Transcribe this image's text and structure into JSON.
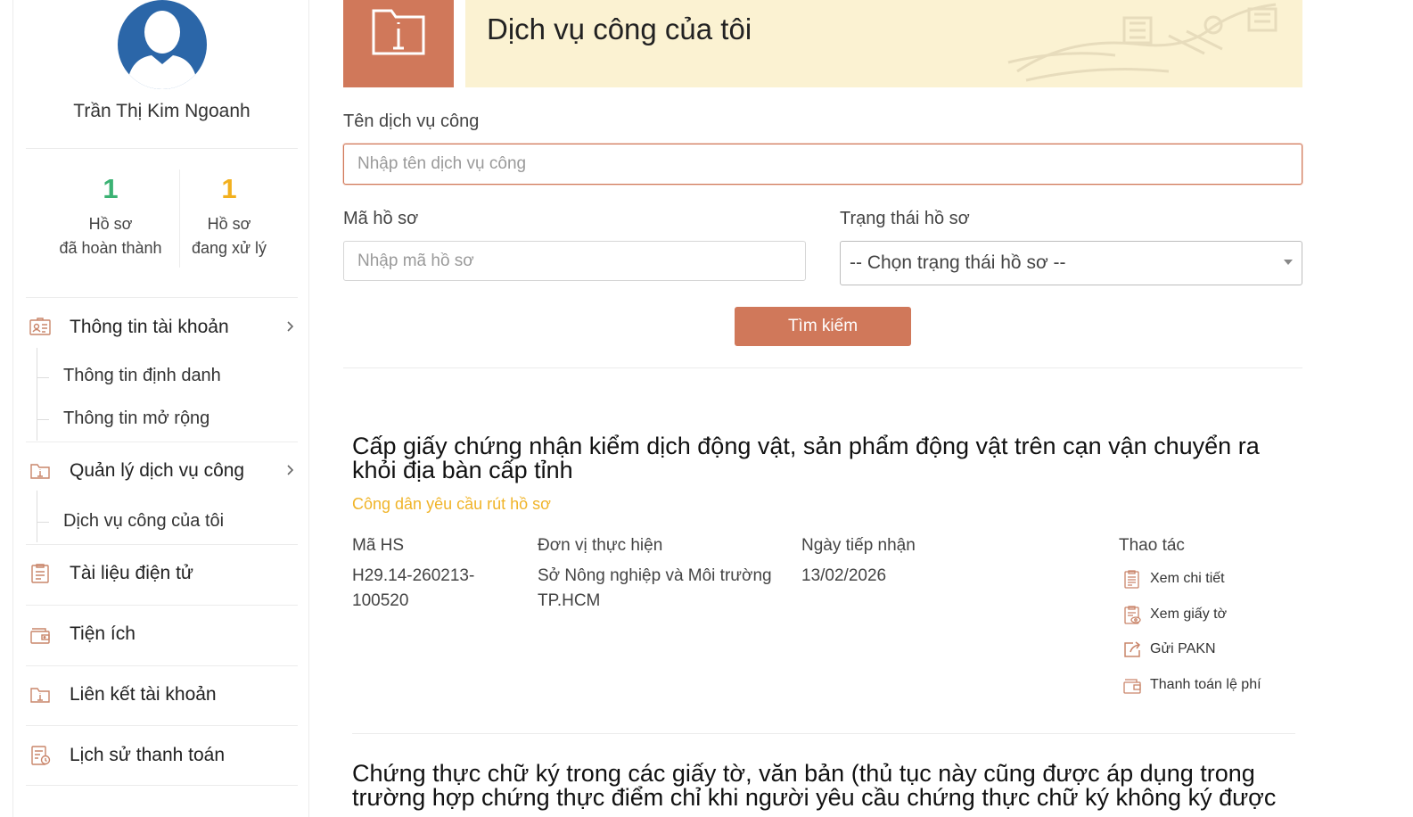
{
  "user": {
    "name": "Trần Thị Kim Ngoanh"
  },
  "stats": {
    "completed": {
      "count": "1",
      "line1": "Hồ sơ",
      "line2": "đã hoàn thành",
      "color": "#3bb273"
    },
    "processing": {
      "count": "1",
      "line1": "Hồ sơ",
      "line2": "đang xử lý",
      "color": "#f2b01e"
    }
  },
  "menu": {
    "account": {
      "label": "Thông tin tài khoản",
      "sub": [
        "Thông tin định danh",
        "Thông tin mở rộng"
      ]
    },
    "services": {
      "label": "Quản lý dịch vụ công",
      "sub": [
        "Dịch vụ công của tôi"
      ]
    },
    "documents": {
      "label": "Tài liệu điện tử"
    },
    "utilities": {
      "label": "Tiện ích"
    },
    "links": {
      "label": "Liên kết tài khoản"
    },
    "payments": {
      "label": "Lịch sử thanh toán"
    }
  },
  "banner": {
    "title": "Dịch vụ công của tôi"
  },
  "search": {
    "service_label": "Tên dịch vụ công",
    "service_placeholder": "Nhập tên dịch vụ công",
    "code_label": "Mã hồ sơ",
    "code_placeholder": "Nhập mã hồ sơ",
    "status_label": "Trạng thái hồ sơ",
    "status_selected": "-- Chọn trạng thái hồ sơ --",
    "button": "Tìm kiếm"
  },
  "records": [
    {
      "title": "Cấp giấy chứng nhận kiểm dịch động vật, sản phẩm động vật trên cạn vận chuyển ra khỏi địa bàn cấp tỉnh",
      "status": "Công dân yêu cầu rút hồ sơ",
      "headers": {
        "code": "Mã HS",
        "unit": "Đơn vị thực hiện",
        "date": "Ngày tiếp nhận",
        "actions": "Thao tác"
      },
      "code": "H29.14-260213-100520",
      "unit": "Sở Nông nghiệp và Môi trường TP.HCM",
      "date": "13/02/2026",
      "actions": [
        "Xem chi tiết",
        "Xem giấy tờ",
        "Gửi PAKN",
        "Thanh toán lệ phí"
      ]
    },
    {
      "title": "Chứng thực chữ ký trong các giấy tờ, văn bản (thủ tục này cũng được áp dụng trong trường hợp chứng thực điểm chỉ khi người yêu cầu chứng thực chữ ký không ký được"
    }
  ],
  "colors": {
    "accent": "#d0785a",
    "banner_bg": "#fbf2d2",
    "status": "#f0b429"
  },
  "icons": [
    "avatar-icon",
    "id-card-icon",
    "folder-info-icon",
    "document-icon",
    "wallet-icon",
    "link-folder-icon",
    "payment-history-icon",
    "chevron-right-icon",
    "clipboard-icon",
    "clipboard-eye-icon",
    "share-icon",
    "wallet-small-icon"
  ]
}
